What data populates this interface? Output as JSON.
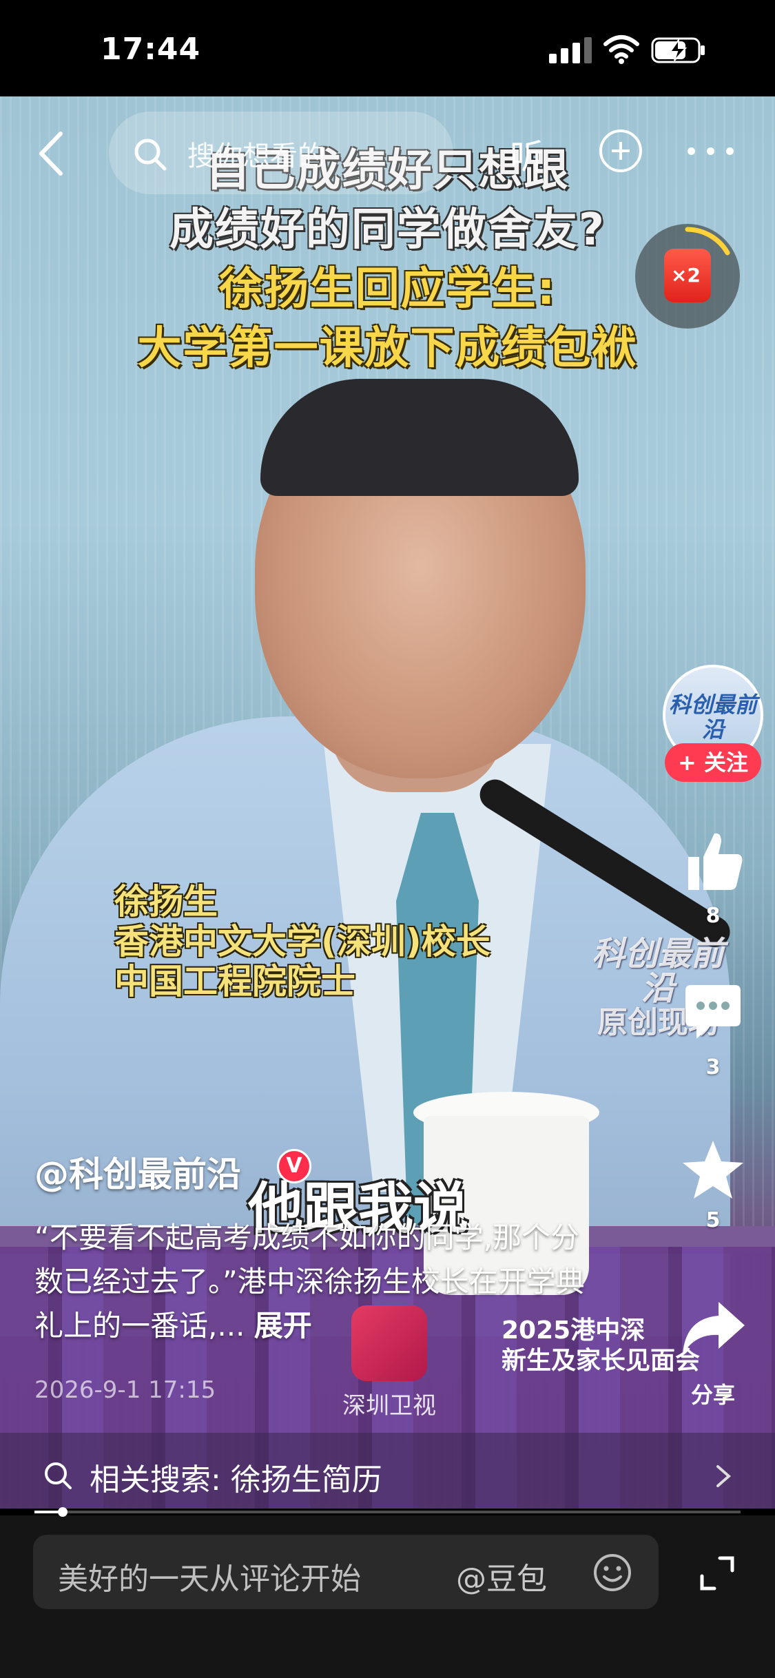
{
  "status": {
    "time": "17:44"
  },
  "topbar": {
    "search_placeholder": "搜你想看的",
    "listen_label": "听"
  },
  "reward": {
    "multiplier": "×2"
  },
  "video": {
    "headline": [
      "自己成绩好只想跟",
      "成绩好的同学做舍友?",
      "徐扬生回应学生:",
      "大学第一课放下成绩包袱"
    ],
    "name_caption": [
      "徐扬生",
      "香港中文大学(深圳)校长",
      "中国工程院院士"
    ],
    "watermark": {
      "top": "科创最前沿",
      "bottom": "原创现场"
    },
    "subtitle": "他跟我说",
    "event_label": [
      "2025港中深",
      "新生及家长见面会"
    ],
    "tv_logo_text": "深圳卫视"
  },
  "rail": {
    "avatar_text": "科创最前沿",
    "follow_label": "+ 关注",
    "likes": "8",
    "comments": "3",
    "favorites": "5",
    "share_label": "分享"
  },
  "post": {
    "author": "@科创最前沿",
    "verified_mark": "V",
    "caption": "“不要看不起高考成绩不如你的同学,那个分数已经过去了。”港中深徐扬生校长在开学典礼上的一番话,... ",
    "expand_label": "展开",
    "time": "2026-9-1 17:15"
  },
  "related": {
    "text": "相关搜索: 徐扬生简历"
  },
  "progress": {
    "fraction": 0.04
  },
  "bottom": {
    "comment_placeholder": "美好的一天从评论开始",
    "mention_label": "@豆包"
  },
  "colors": {
    "accent": "#ff3b52",
    "headline_yellow": "#f8d84a",
    "caption_yellow": "#f6e27a"
  }
}
